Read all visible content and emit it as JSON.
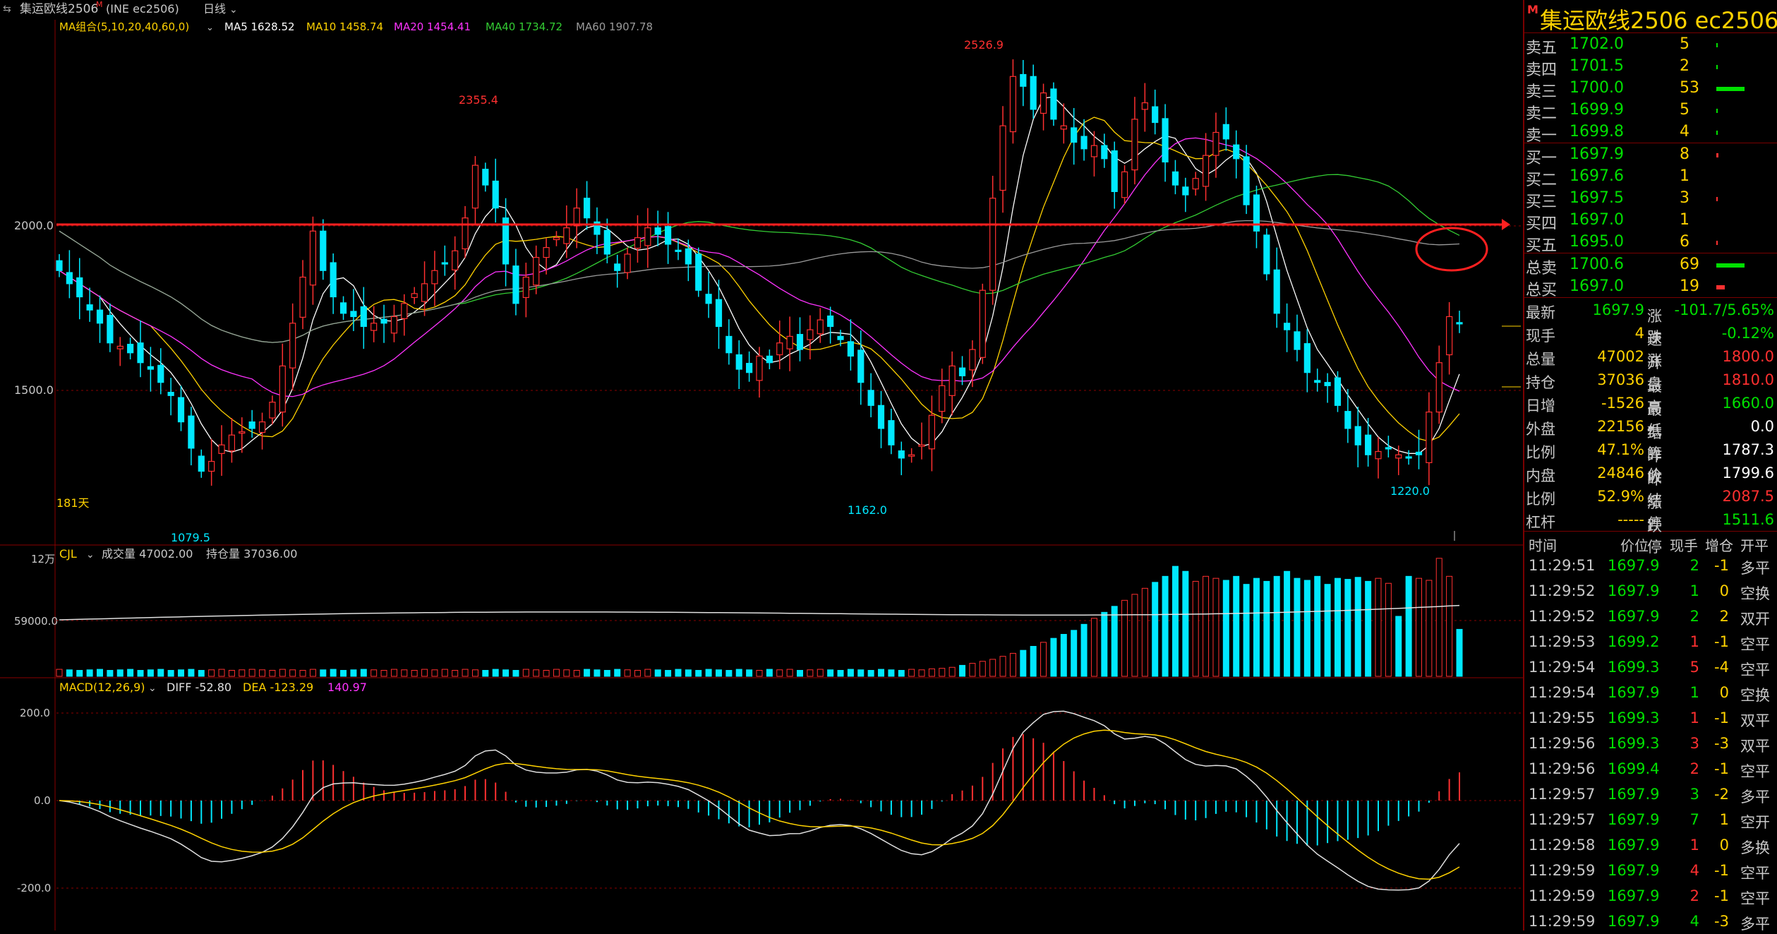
{
  "chart_title": "集运欧线2506",
  "chart_title_super": "M",
  "chart_subtitle": "(INE ec2506)",
  "period_label": "日线",
  "ma_legend": [
    {
      "label": "MA组合(5,10,20,40,60,0)",
      "color": "#ffd200"
    },
    {
      "label": "MA5 1628.52",
      "color": "#ffffff"
    },
    {
      "label": "MA10 1458.74",
      "color": "#ffd200"
    },
    {
      "label": "MA20 1454.41",
      "color": "#ff33ff"
    },
    {
      "label": "MA40 1734.72",
      "color": "#33cc33"
    },
    {
      "label": "MA60 1907.78",
      "color": "#9a9a9a"
    }
  ],
  "days_label": "181天",
  "price_axis": {
    "ticks": [
      "2000.0",
      "1500.0"
    ]
  },
  "annotations": {
    "high1": "2355.4",
    "high2": "2526.9",
    "low1": "1079.5",
    "low2": "1162.0",
    "low3": "1220.0"
  },
  "volume_panel": {
    "legend": "CJL",
    "vol_label": "成交量 47002.00",
    "oi_label": "持仓量 37036.00",
    "ticks": [
      "12万",
      "59000.0"
    ]
  },
  "macd_panel": {
    "legend": "MACD(12,26,9)",
    "diff": "DIFF -52.80",
    "dea": "DEA -123.29",
    "macd": "140.97",
    "ticks": [
      "200.0",
      "0.0",
      "-200.0"
    ]
  },
  "chart_data": {
    "type": "candlestick",
    "title": "集运欧线2506",
    "ylim": [
      1079.5,
      2526.9
    ],
    "reference_line": 2000.0,
    "close": [
      1860,
      1820,
      1780,
      1740,
      1700,
      1640,
      1630,
      1610,
      1580,
      1560,
      1520,
      1480,
      1400,
      1320,
      1250,
      1280,
      1330,
      1360,
      1370,
      1380,
      1400,
      1460,
      1570,
      1700,
      1840,
      1980,
      1860,
      1780,
      1730,
      1720,
      1690,
      1700,
      1700,
      1720,
      1760,
      1790,
      1820,
      1860,
      1880,
      1920,
      2020,
      2180,
      2120,
      2050,
      1880,
      1760,
      1840,
      1900,
      1930,
      1960,
      1990,
      2050,
      2020,
      1970,
      1910,
      1860,
      1910,
      1960,
      1990,
      1970,
      1940,
      1920,
      1880,
      1800,
      1760,
      1690,
      1610,
      1560,
      1550,
      1600,
      1580,
      1640,
      1660,
      1620,
      1680,
      1710,
      1690,
      1650,
      1600,
      1520,
      1450,
      1380,
      1330,
      1290,
      1300,
      1330,
      1420,
      1510,
      1570,
      1540,
      1620,
      1800,
      2080,
      2300,
      2450,
      2420,
      2350,
      2400,
      2320,
      2300,
      2250,
      2230,
      2240,
      2200,
      2100,
      2160,
      2320,
      2370,
      2310,
      2190,
      2120,
      2090,
      2140,
      2210,
      2280,
      2260,
      2200,
      2060,
      1980,
      1850,
      1730,
      1680,
      1620,
      1550,
      1520,
      1510,
      1450,
      1380,
      1330,
      1300,
      1310,
      1320,
      1300,
      1290,
      1300,
      1430,
      1580,
      1720,
      1697.9
    ],
    "volume": [
      7000,
      6500,
      6000,
      6500,
      7000,
      6000,
      6500,
      7000,
      6000,
      6500,
      7000,
      6000,
      6500,
      7000,
      6000,
      6500,
      7000,
      6000,
      6500,
      7000,
      6500,
      6000,
      7000,
      6500,
      6000,
      7000,
      6500,
      7000,
      6000,
      6500,
      7000,
      6500,
      6000,
      7000,
      6500,
      6000,
      7000,
      6500,
      7000,
      6000,
      7000,
      6500,
      6000,
      7000,
      6500,
      6000,
      7000,
      6500,
      6000,
      7000,
      6500,
      6000,
      7000,
      6500,
      6000,
      7000,
      6500,
      6000,
      7000,
      6500,
      6000,
      7000,
      6500,
      6000,
      7000,
      6500,
      6000,
      7000,
      6500,
      6000,
      7000,
      6500,
      7000,
      6000,
      6500,
      7000,
      6500,
      6000,
      7000,
      6500,
      6000,
      7000,
      6500,
      6000,
      7000,
      6500,
      7500,
      8000,
      9000,
      11000,
      13000,
      15000,
      17000,
      20000,
      23000,
      26000,
      30000,
      34000,
      38000,
      42000,
      46000,
      52000,
      58000,
      64000,
      70000,
      76000,
      82000,
      88000,
      94000,
      100000,
      110000,
      105000,
      95000,
      100000,
      98000,
      96000,
      100000,
      92000,
      98000,
      95000,
      100000,
      105000,
      98000,
      96000,
      100000,
      92000,
      98000,
      97000,
      99000,
      95000,
      98000,
      93000,
      60000,
      100000,
      98000,
      96000,
      118000,
      100000,
      47002
    ],
    "macd_diff": -52.8,
    "macd_dea": -123.29,
    "macd_hist": 140.97
  },
  "sidebar": {
    "title": "集运欧线2506",
    "code": "ec2506",
    "title_mark": "M",
    "orderbook": {
      "asks": [
        {
          "label": "卖五",
          "price": "1702.0",
          "vol": "5",
          "bar": 0.04
        },
        {
          "label": "卖四",
          "price": "1701.5",
          "vol": "2",
          "bar": 0.02
        },
        {
          "label": "卖三",
          "price": "1700.0",
          "vol": "53",
          "bar": 1.0
        },
        {
          "label": "卖二",
          "price": "1699.9",
          "vol": "5",
          "bar": 0.04
        },
        {
          "label": "卖一",
          "price": "1699.8",
          "vol": "4",
          "bar": 0.04
        }
      ],
      "bids": [
        {
          "label": "买一",
          "price": "1697.9",
          "vol": "8",
          "bar": 0.08
        },
        {
          "label": "买二",
          "price": "1697.6",
          "vol": "1",
          "bar": 0
        },
        {
          "label": "买三",
          "price": "1697.5",
          "vol": "3",
          "bar": 0.04
        },
        {
          "label": "买四",
          "price": "1697.0",
          "vol": "1",
          "bar": 0
        },
        {
          "label": "买五",
          "price": "1695.0",
          "vol": "6",
          "bar": 0.06
        }
      ],
      "totals": [
        {
          "label": "总卖",
          "price": "1700.6",
          "vol": "69",
          "color": "#00e000",
          "bar": 1.0
        },
        {
          "label": "总买",
          "price": "1697.0",
          "vol": "19",
          "color": "#ff3030",
          "bar": 0.3
        }
      ]
    },
    "quote": [
      {
        "l1": "最新",
        "v1": "1697.9",
        "c1": "#00e000",
        "l2": "涨跌",
        "v2": "-101.7/5.65%",
        "c2": "#00e000"
      },
      {
        "l1": "现手",
        "v1": "4",
        "c1": "#ffd200",
        "l2": "速涨",
        "v2": "-0.12%",
        "c2": "#00e000"
      },
      {
        "l1": "总量",
        "v1": "47002",
        "c1": "#ffd200",
        "l2": "开盘",
        "v2": "1800.0",
        "c2": "#ff3030"
      },
      {
        "l1": "持仓",
        "v1": "37036",
        "c1": "#ffd200",
        "l2": "最高",
        "v2": "1810.0",
        "c2": "#ff3030"
      },
      {
        "l1": "日增",
        "v1": "-1526",
        "c1": "#ffd200",
        "l2": "最低",
        "v2": "1660.0",
        "c2": "#00e000"
      },
      {
        "l1": "外盘",
        "v1": "22156",
        "c1": "#ffd200",
        "l2": "结算价",
        "v2": "0.0",
        "c2": "#ffffff",
        "dropdown": "⏷"
      },
      {
        "l1": "比例",
        "v1": "47.1%",
        "c1": "#ffd200",
        "l2": "昨收",
        "v2": "1787.3",
        "c2": "#ffffff"
      },
      {
        "l1": "内盘",
        "v1": "24846",
        "c1": "#ffd200",
        "l2": "昨结",
        "v2": "1799.6",
        "c2": "#ffffff"
      },
      {
        "l1": "比例",
        "v1": "52.9%",
        "c1": "#ffd200",
        "l2": "涨停",
        "v2": "2087.5",
        "c2": "#ff3030"
      },
      {
        "l1": "杠杆",
        "v1": "-----",
        "c1": "#ffd200",
        "l2": "跌停",
        "v2": "1511.6",
        "c2": "#00e000"
      }
    ],
    "ticks_header": [
      "时间",
      "价位",
      "现手",
      "增仓",
      "开平"
    ],
    "ticks": [
      {
        "time": "11:29:51",
        "price": "1697.9",
        "vol": "2",
        "chg": "-1",
        "type": "多平",
        "vc": "#00e000"
      },
      {
        "time": "11:29:52",
        "price": "1697.9",
        "vol": "1",
        "chg": "0",
        "type": "空换",
        "vc": "#00e000"
      },
      {
        "time": "11:29:52",
        "price": "1697.9",
        "vol": "2",
        "chg": "2",
        "type": "双开",
        "vc": "#00e000"
      },
      {
        "time": "11:29:53",
        "price": "1699.2",
        "vol": "1",
        "chg": "-1",
        "type": "空平",
        "vc": "#ff3030"
      },
      {
        "time": "11:29:54",
        "price": "1699.3",
        "vol": "5",
        "chg": "-4",
        "type": "空平",
        "vc": "#ff3030"
      },
      {
        "time": "11:29:54",
        "price": "1697.9",
        "vol": "1",
        "chg": "0",
        "type": "空换",
        "vc": "#00e000"
      },
      {
        "time": "11:29:55",
        "price": "1699.3",
        "vol": "1",
        "chg": "-1",
        "type": "双平",
        "vc": "#ff3030"
      },
      {
        "time": "11:29:56",
        "price": "1699.3",
        "vol": "3",
        "chg": "-3",
        "type": "双平",
        "vc": "#ff3030"
      },
      {
        "time": "11:29:56",
        "price": "1699.4",
        "vol": "2",
        "chg": "-1",
        "type": "空平",
        "vc": "#ff3030"
      },
      {
        "time": "11:29:57",
        "price": "1697.9",
        "vol": "3",
        "chg": "-2",
        "type": "多平",
        "vc": "#00e000"
      },
      {
        "time": "11:29:57",
        "price": "1697.9",
        "vol": "7",
        "chg": "1",
        "type": "空开",
        "vc": "#00e000"
      },
      {
        "time": "11:29:58",
        "price": "1697.9",
        "vol": "1",
        "chg": "0",
        "type": "多换",
        "vc": "#ff3030"
      },
      {
        "time": "11:29:59",
        "price": "1697.9",
        "vol": "4",
        "chg": "-1",
        "type": "空平",
        "vc": "#ff3030"
      },
      {
        "time": "11:29:59",
        "price": "1697.9",
        "vol": "2",
        "chg": "-1",
        "type": "空平",
        "vc": "#ff3030"
      },
      {
        "time": "11:29:59",
        "price": "1697.9",
        "vol": "4",
        "chg": "-3",
        "type": "多平",
        "vc": "#00e000"
      }
    ]
  }
}
